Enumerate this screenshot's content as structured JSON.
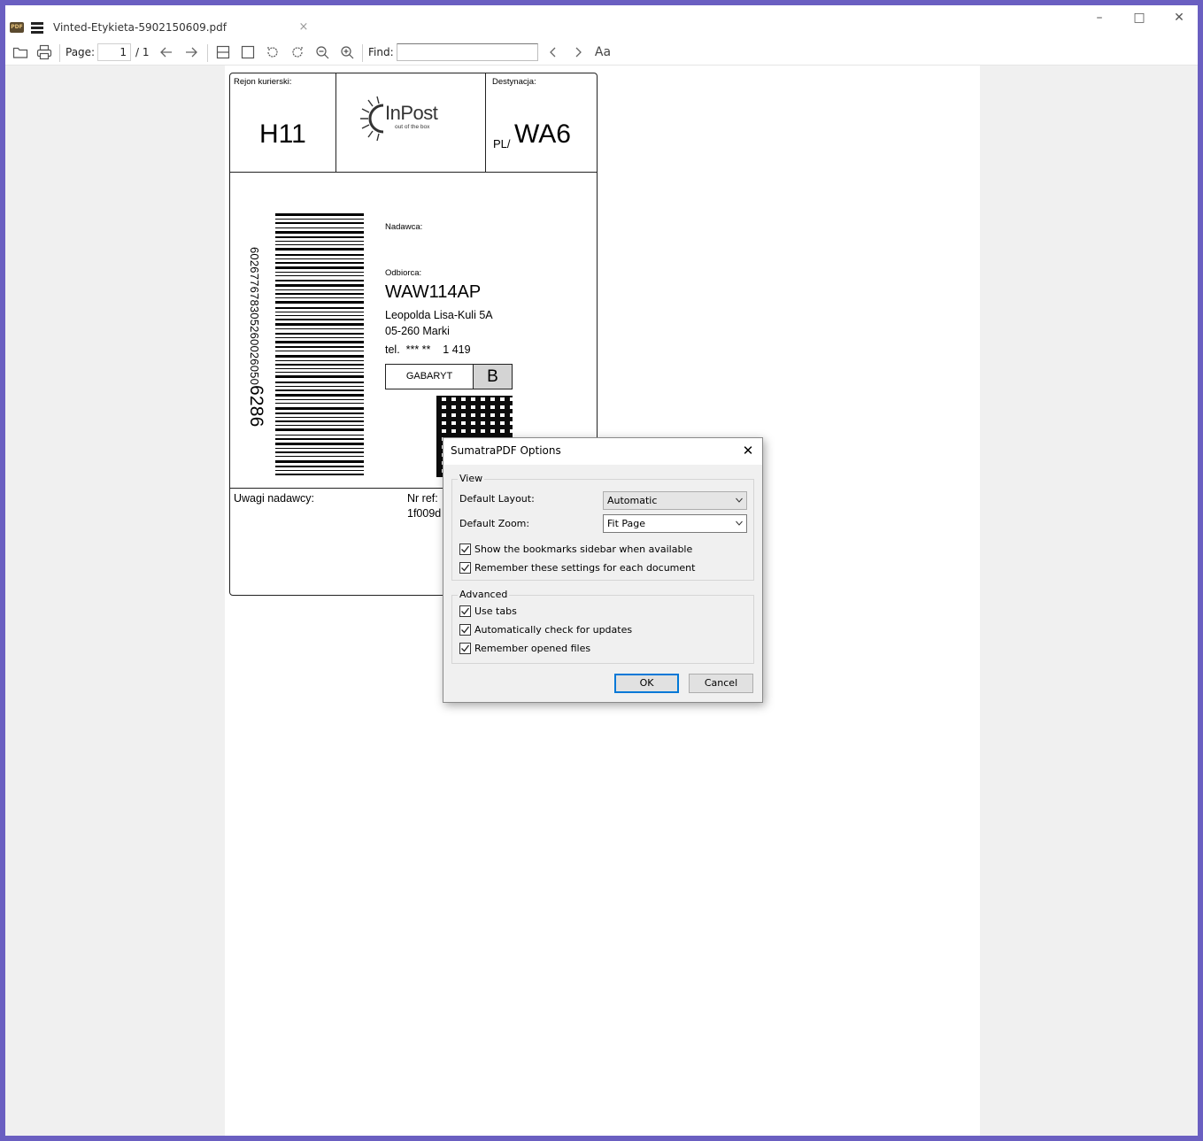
{
  "window": {
    "tab_title": "Vinted-Etykieta-5902150609.pdf",
    "tab_close": "×",
    "app_icon_text": "PDF",
    "minimize": "–",
    "maximize": "□",
    "close": "✕"
  },
  "toolbar": {
    "page_label": "Page:",
    "page_current": "1",
    "page_total": "/ 1",
    "find_label": "Find:",
    "find_value": "",
    "icons": [
      "open-folder-icon",
      "print-icon",
      "prev-page-icon",
      "next-page-icon",
      "continuous-view-icon",
      "single-page-icon",
      "rotate-left-icon",
      "rotate-right-icon",
      "zoom-out-icon",
      "zoom-in-icon",
      "find-prev-icon",
      "find-next-icon",
      "match-case-icon"
    ],
    "match_case_label": "Aa"
  },
  "label": {
    "region_label": "Rejon kurierski:",
    "region_value": "H11",
    "logo_text": "InPost",
    "logo_tagline": "out of the box",
    "dest_label": "Destynacja:",
    "dest_prefix": "PL/",
    "dest_value": "WA6",
    "barcode_number_main": "602677678305260026050",
    "barcode_number_tail": "6286",
    "sender_label": "Nadawca:",
    "recipient_label": "Odbiorca:",
    "recipient_code": "WAW114AP",
    "address_line1": "Leopolda Lisa-Kuli 5A",
    "address_line2": "05-260 Marki",
    "phone": "tel.  *** **    1 419",
    "size_label": "GABARYT",
    "size_value": "B",
    "notes_label": "Uwagi nadawcy:",
    "ref_label": "Nr ref:",
    "ref_value": "1f009d"
  },
  "dialog": {
    "title": "SumatraPDF Options",
    "close": "✕",
    "view_legend": "View",
    "layout_label": "Default Layout:",
    "layout_value": "Automatic",
    "zoom_label": "Default Zoom:",
    "zoom_value": "Fit Page",
    "cb_bookmarks": "Show the bookmarks sidebar when available",
    "cb_remember_settings": "Remember these settings for each document",
    "advanced_legend": "Advanced",
    "cb_tabs": "Use tabs",
    "cb_updates": "Automatically check for updates",
    "cb_remember_files": "Remember opened files",
    "ok": "OK",
    "cancel": "Cancel"
  }
}
